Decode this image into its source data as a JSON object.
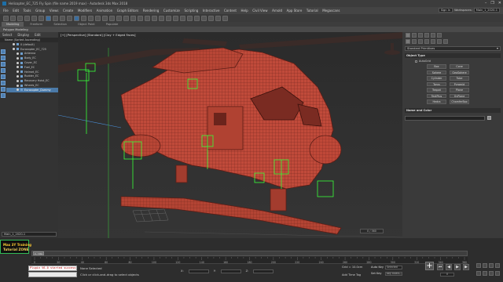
{
  "app": {
    "title": "Helicopter_EC_725 Fly Spin (file name 2019 max) - Autodesk 3ds Max 2018"
  },
  "window_controls": [
    "–",
    "❐",
    "✕"
  ],
  "menubar": {
    "items": [
      "File",
      "Edit",
      "Tools",
      "Group",
      "Views",
      "Create",
      "Modifiers",
      "Animation",
      "Graph Editors",
      "Rendering",
      "Customize",
      "Scripting",
      "Interactive",
      "Content",
      "Help",
      "Civil View",
      "Arnold",
      "App Store",
      "Tutorial",
      "Megascans"
    ],
    "signin_label": "Sign In",
    "workspaces_label": "Workspaces:",
    "workspace_value": "Main_1_2020-1"
  },
  "ribbon": {
    "tabs": [
      "Modeling",
      "Freeform",
      "Selection",
      "Object Paint",
      "Populate"
    ],
    "active_tab": "Modeling",
    "sub_label": "Polygon Modeling"
  },
  "scene_explorer": {
    "tabs": [
      "Select",
      "Display",
      "Edit"
    ],
    "header": "Name (Sorted Ascending)",
    "rows": [
      {
        "label": "0 (default)",
        "selected": false,
        "indent": 1
      },
      {
        "label": "Eurocopter_EC_725",
        "selected": false,
        "indent": 1
      },
      {
        "label": "Antenna",
        "selected": false,
        "indent": 2
      },
      {
        "label": "Body_EC",
        "selected": false,
        "indent": 2
      },
      {
        "label": "Cover_EC",
        "selected": false,
        "indent": 2
      },
      {
        "label": "Fuel_EC",
        "selected": false,
        "indent": 2
      },
      {
        "label": "Helmet_EC",
        "selected": false,
        "indent": 2
      },
      {
        "label": "Rudder_EC",
        "selected": false,
        "indent": 2
      },
      {
        "label": "Recovery Hoist_EC",
        "selected": false,
        "indent": 2
      },
      {
        "label": "Wheels_EC",
        "selected": false,
        "indent": 2
      },
      {
        "label": "Eurocopter_Dummy",
        "selected": true,
        "indent": 2
      }
    ],
    "layer_label": "Main_1_2020-1"
  },
  "viewport": {
    "label": "[+] [Perspective] [Standard] [Clay + Edged Faces]",
    "helicopter_color": "#c04a3a",
    "wire_color": "#5c1d16",
    "helper_color": "#39ff39"
  },
  "command_panel": {
    "dropdown": "Standard Primitives",
    "object_type_title": "Object Type",
    "autogrid": "AutoGrid",
    "buttons": [
      "Box",
      "Cone",
      "Sphere",
      "GeoSphere",
      "Cylinder",
      "Tube",
      "Torus",
      "Pyramid",
      "Teapot",
      "Plane",
      "TextPlus",
      "GyPlane",
      "Hedra",
      "ChamferBox"
    ],
    "name_color_title": "Name and Color"
  },
  "timeline": {
    "thumb": "0 / 360",
    "frame_readout": "0 / 360",
    "ruler_ticks": [
      "0",
      "20",
      "40",
      "60",
      "80",
      "100",
      "120",
      "140",
      "160",
      "180",
      "200",
      "220",
      "240",
      "260",
      "280",
      "300",
      "320",
      "340",
      "360"
    ]
  },
  "logo": {
    "line1": "Max 3Y Training",
    "line2": "Tutorial ZONE"
  },
  "status": {
    "maxscript": "Plugin V6.0 started successfully",
    "line1": "None Selected",
    "line2": "Click or click-and-drag to select objects",
    "grid": "Grid = 10.0cm",
    "add_time_tag": "Add Time Tag",
    "auto_key": "Auto Key",
    "set_key": "Set Key",
    "selected_value": "Selected",
    "key_filters": "Key Filters...",
    "frame_field": "0"
  }
}
